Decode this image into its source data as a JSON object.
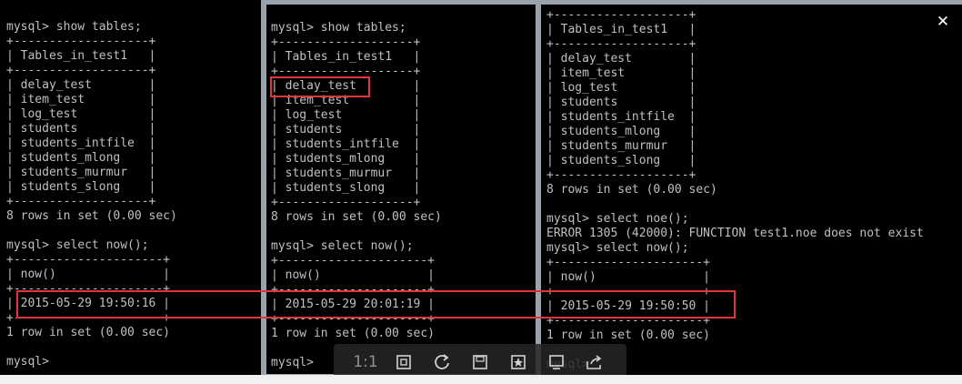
{
  "terminals": [
    {
      "lines": [
        "mysql> show tables;",
        "+-------------------+",
        "| Tables_in_test1   |",
        "+-------------------+",
        "| delay_test        |",
        "| item_test         |",
        "| log_test          |",
        "| students          |",
        "| students_intfile  |",
        "| students_mlong    |",
        "| students_murmur   |",
        "| students_slong    |",
        "+-------------------+",
        "8 rows in set (0.00 sec)",
        "",
        "mysql> select now();",
        "+---------------------+",
        "| now()               |",
        "+---------------------+",
        "| 2015-05-29 19:50:16 |",
        "+---------------------+",
        "1 row in set (0.00 sec)",
        "",
        "mysql>"
      ]
    },
    {
      "lines": [
        "mysql> show tables;",
        "+-------------------+",
        "| Tables_in_test1   |",
        "+-------------------+",
        "| delay_test        |",
        "| item_test         |",
        "| log_test          |",
        "| students          |",
        "| students_intfile  |",
        "| students_mlong    |",
        "| students_murmur   |",
        "| students_slong    |",
        "+-------------------+",
        "8 rows in set (0.00 sec)",
        "",
        "mysql> select now();",
        "+---------------------+",
        "| now()               |",
        "+---------------------+",
        "| 2015-05-29 20:01:19 |",
        "+---------------------+",
        "1 row in set (0.00 sec)",
        "",
        "mysql>"
      ]
    },
    {
      "lines": [
        "+-------------------+",
        "| Tables_in_test1   |",
        "+-------------------+",
        "| delay_test        |",
        "| item_test         |",
        "| log_test          |",
        "| students          |",
        "| students_intfile  |",
        "| students_mlong    |",
        "| students_murmur   |",
        "| students_slong    |",
        "+-------------------+",
        "8 rows in set (0.00 sec)",
        "",
        "mysql> select noe();",
        "ERROR 1305 (42000): FUNCTION test1.noe does not exist",
        "mysql> select now();",
        "+---------------------+",
        "| now()               |",
        "+---------------------+",
        "| 2015-05-29 19:50:50 |",
        "+---------------------+",
        "1 row in set (0.00 sec)",
        "",
        "mysql>"
      ]
    }
  ],
  "viewer": {
    "close_label": "✕",
    "toolbar": {
      "actual_size_label": "1:1",
      "icons": [
        "fit-screen-icon",
        "rotate-icon",
        "save-icon",
        "favorite-icon",
        "slideshow-icon",
        "share-icon"
      ]
    }
  },
  "colors": {
    "terminal_bg": "#000000",
    "terminal_text": "#c0c0c0",
    "highlight": "#e0353a"
  }
}
